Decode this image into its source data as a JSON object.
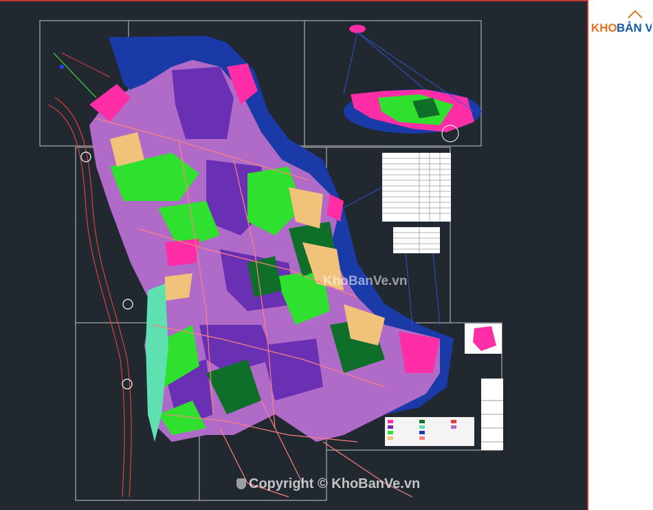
{
  "brand": {
    "logo_text_1": "KHO",
    "logo_text_2": "BẢN VẼ",
    "accent_orange": "#e8731e",
    "accent_blue": "#0f5aa8"
  },
  "watermark": {
    "center_text": "KhoBanVe.vn",
    "copyright_text": "Copyright © KhoBanVe.vn"
  },
  "map": {
    "background": "#212830",
    "frame_border": "#c0392b",
    "layer_colors": {
      "sea": "#1a3aa8",
      "residential": "#7a3dbd",
      "mixed_use": "#b06ac8",
      "green_space": "#2fe02f",
      "forest": "#0e6e2a",
      "commercial": "#ff2ea6",
      "yellow_land": "#f0c27a",
      "water_green": "#5fe0b0",
      "road": "#ff6b6b"
    },
    "icons": [
      "north-arrow-icon",
      "compass-icon",
      "island-inset-icon",
      "location-inset-icon"
    ]
  }
}
